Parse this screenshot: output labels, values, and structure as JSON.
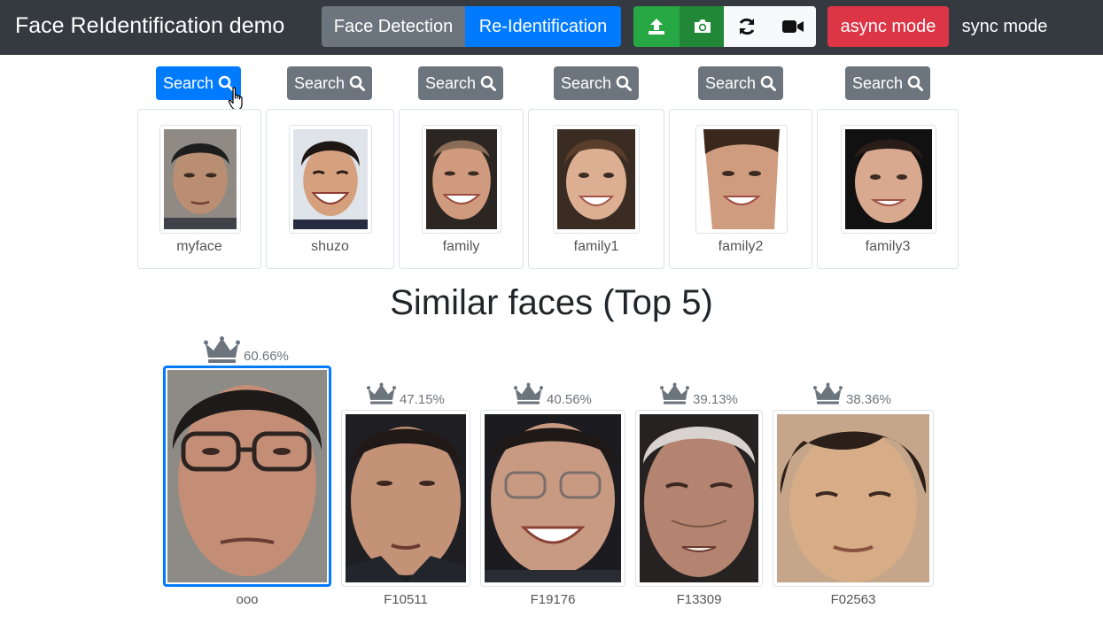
{
  "navbar": {
    "brand": "Face ReIdentification demo",
    "modes": [
      "Face Detection",
      "Re-Identification"
    ],
    "active_mode": "Re-Identification",
    "tools": [
      "upload-icon",
      "camera-icon",
      "sync-icon",
      "video-icon"
    ],
    "async_label": "async mode",
    "sync_label": "sync mode"
  },
  "search": {
    "button_label": "Search",
    "active_index": 0,
    "registered": [
      {
        "label": "myface"
      },
      {
        "label": "shuzo"
      },
      {
        "label": "family"
      },
      {
        "label": "family1"
      },
      {
        "label": "family2"
      },
      {
        "label": "family3"
      }
    ]
  },
  "results": {
    "heading": "Similar faces (Top 5)",
    "items": [
      {
        "id": "ooo",
        "score": "60.66%"
      },
      {
        "id": "F10511",
        "score": "47.15%"
      },
      {
        "id": "F19176",
        "score": "40.56%"
      },
      {
        "id": "F13309",
        "score": "39.13%"
      },
      {
        "id": "F02563",
        "score": "38.36%"
      }
    ]
  },
  "colors": {
    "navbar_bg": "#343a40",
    "primary": "#007bff",
    "secondary": "#6c757d",
    "success": "#28a745",
    "danger": "#dc3545",
    "light": "#f8f9fa"
  }
}
